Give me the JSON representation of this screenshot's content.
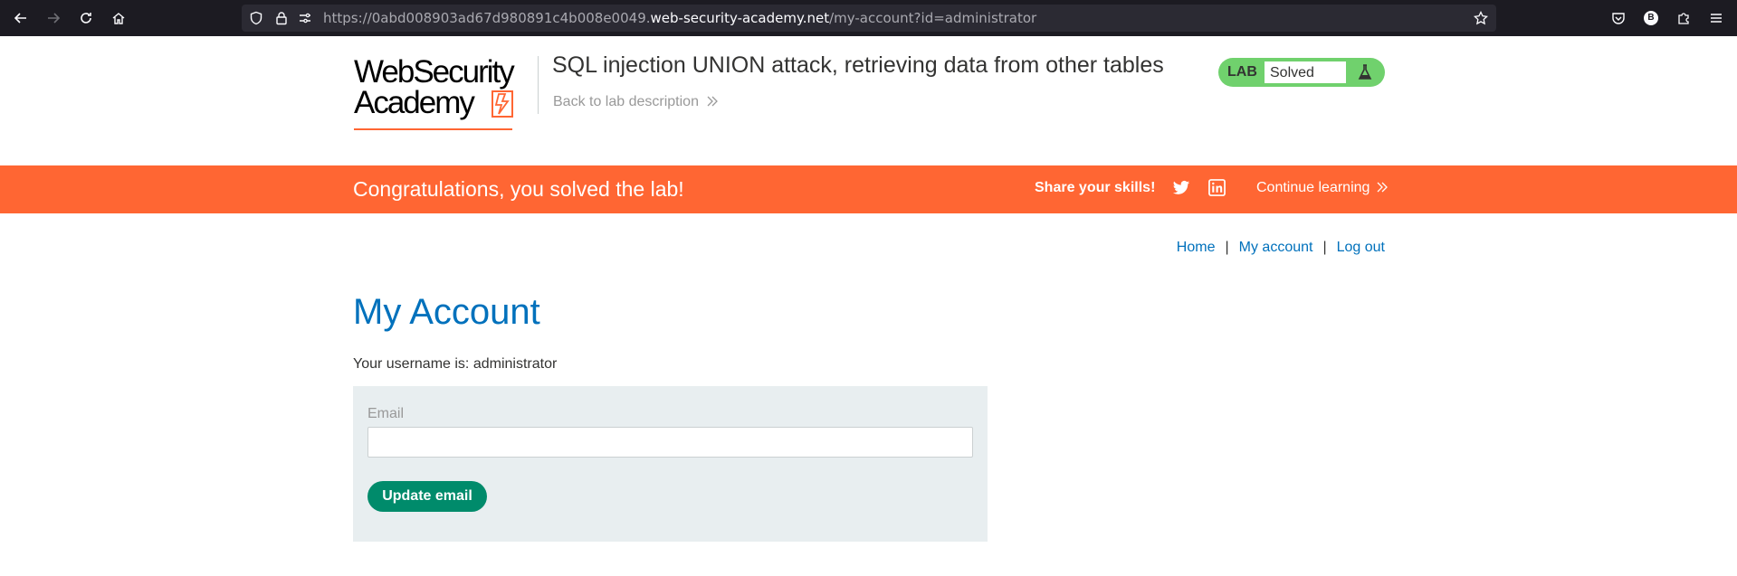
{
  "browser": {
    "url_prefix": "https://0abd008903ad67d980891c4b008e0049.",
    "url_host": "web-security-academy.net",
    "url_path": "/my-account?id=administrator",
    "profile_initial": "B"
  },
  "header": {
    "logo_line1": "WebSecurity",
    "logo_line2": "Academy",
    "lab_title": "SQL injection UNION attack, retrieving data from other tables",
    "back_link": "Back to lab description",
    "status_tag": "LAB",
    "status_text": "Solved",
    "status_color": "#70d16d"
  },
  "banner": {
    "title": "Congratulations, you solved the lab!",
    "share_label": "Share your skills!",
    "continue_label": "Continue learning",
    "color": "#ff6633"
  },
  "nav": {
    "home": "Home",
    "my_account": "My account",
    "log_out": "Log out",
    "separator": "|"
  },
  "main": {
    "heading": "My Account",
    "username_line": "Your username is: administrator",
    "email_label": "Email",
    "email_value": "",
    "update_button": "Update email"
  }
}
